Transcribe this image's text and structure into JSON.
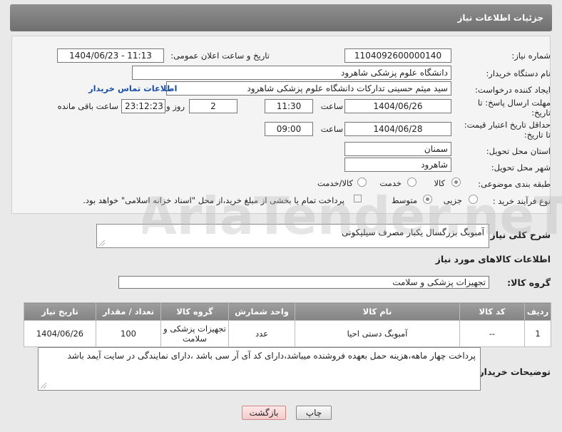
{
  "header": {
    "title": "جزئیات اطلاعات نیاز"
  },
  "form": {
    "need_number_label": "شماره نیاز:",
    "need_number": "1104092600000140",
    "announce_label": "تاریخ و ساعت اعلان عمومی:",
    "announce_value": "1404/06/23 - 11:13",
    "buyer_org_label": "نام دستگاه خریدار:",
    "buyer_org": "دانشگاه علوم پزشکی شاهرود",
    "creator_label": "ایجاد کننده درخواست:",
    "creator": "سید میثم حسینی تدارکات دانشگاه علوم پزشکی شاهرود",
    "contact_link": "اطلاعات تماس خریدار",
    "deadline_label_1": "مهلت ارسال پاسخ: تا",
    "deadline_label_2": "تاریخ:",
    "deadline_date": "1404/06/26",
    "time_label": "ساعت",
    "deadline_time": "11:30",
    "days_value": "2",
    "days_label": "روز و",
    "remaining_time": "23:12:23",
    "remaining_label": "ساعت باقی مانده",
    "validity_label_1": "حداقل تاریخ اعتبار قیمت:",
    "validity_label_2": "تا تاریخ:",
    "validity_date": "1404/06/28",
    "validity_time": "09:00",
    "province_label": "استان محل تحویل:",
    "province": "سمنان",
    "city_label": "شهر محل تحویل:",
    "city": "شاهرود",
    "category_label": "طبقه بندی موضوعی:",
    "category_options": [
      "کالا",
      "خدمت",
      "کالا/خدمت"
    ],
    "process_label": "نوع فرآیند خرید :",
    "process_options": [
      "جزیی",
      "متوسط"
    ],
    "payment_note": "پرداخت تمام یا بخشی از مبلغ خرید،از محل \"اسناد خزانه اسلامی\" خواهد بود."
  },
  "description": {
    "label": "شرح کلی نیاز:",
    "value": "آمبوبگ  بزرگسال یکبار مصرف سیلیکونی"
  },
  "goods": {
    "section_title": "اطلاعات کالاهای مورد نیاز",
    "group_label": "گروه کالا:",
    "group_value": "تجهیزات پزشکی و سلامت",
    "columns": [
      "ردیف",
      "کد کالا",
      "نام کالا",
      "واحد شمارش",
      "گروه کالا",
      "تعداد / مقدار",
      "تاریخ نیاز"
    ],
    "rows": [
      {
        "row": "1",
        "code": "--",
        "name": "آمبوبگ دستی احیا",
        "unit": "عدد",
        "group": "تجهیزات پزشکی و سلامت",
        "qty": "100",
        "date": "1404/06/26"
      }
    ]
  },
  "buyer_notes": {
    "label": "توضیحات خریدار:",
    "value": "پرداخت چهار ماهه،هزینه  حمل بعهده فروشنده میباشد،دارای  کد آی آر سی باشد ،دارای نمایندگی در سایت آیمد باشد"
  },
  "buttons": {
    "print": "چاپ",
    "back": "بازگشت"
  },
  "watermark": {
    "text": "AriaTender.neT"
  }
}
